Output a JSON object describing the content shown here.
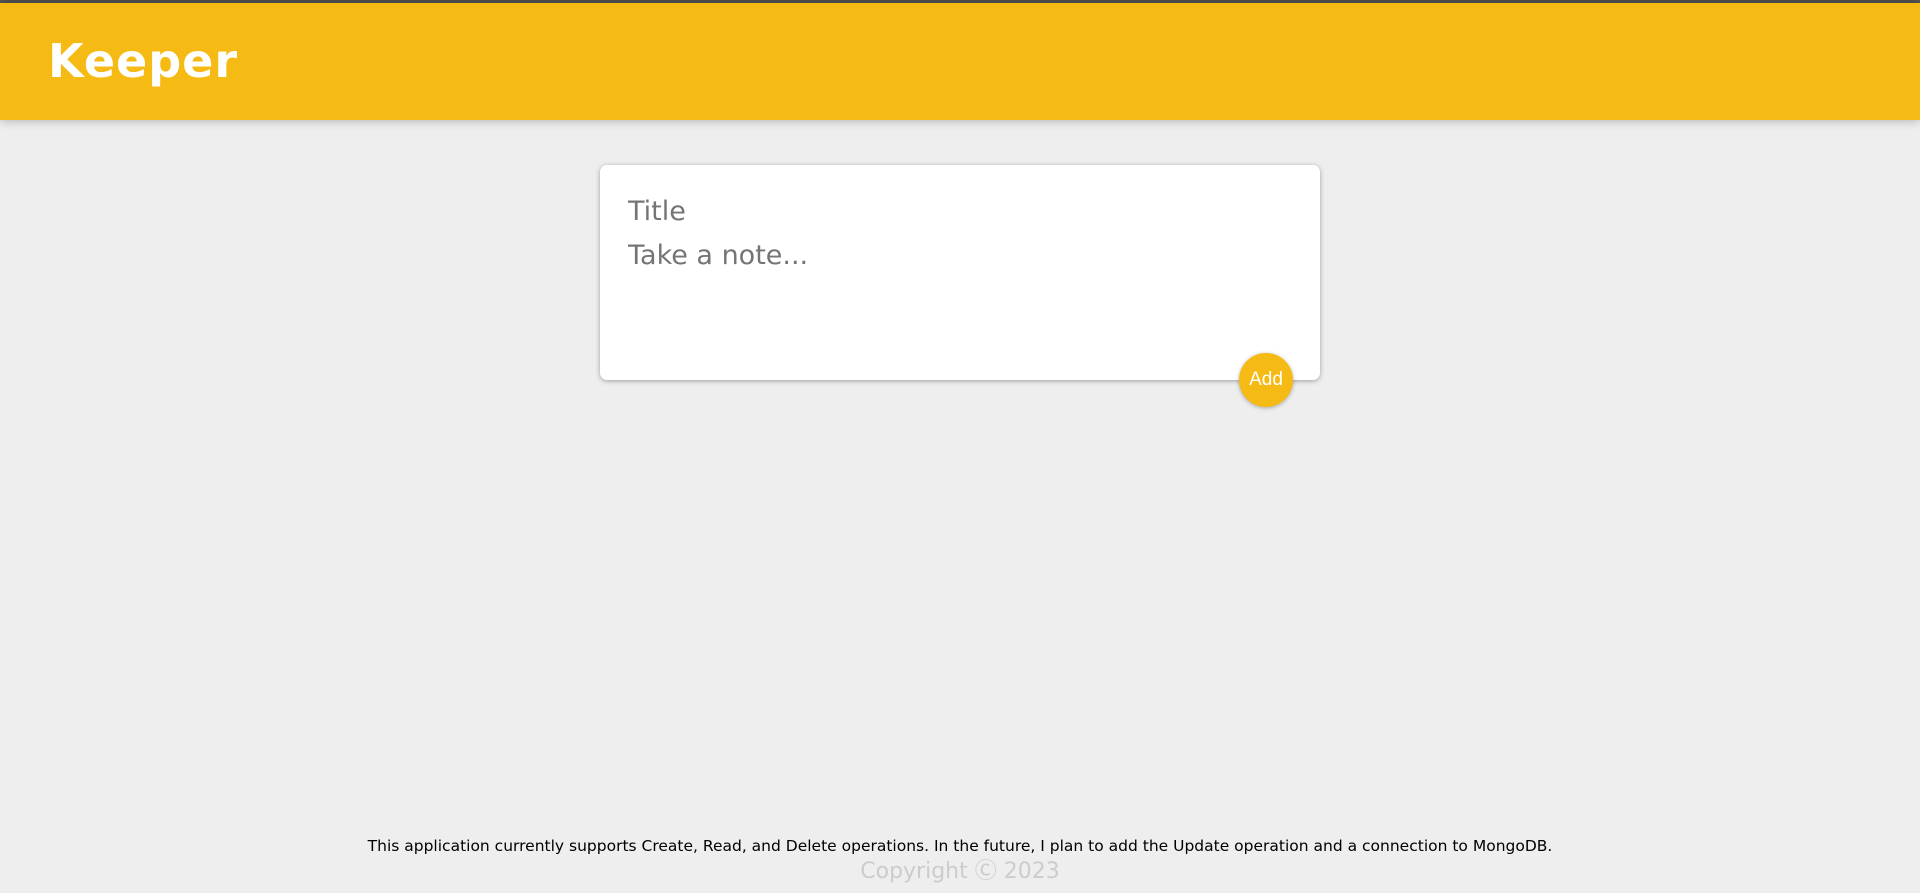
{
  "header": {
    "title": "Keeper"
  },
  "note_form": {
    "title_placeholder": "Title",
    "content_placeholder": "Take a note...",
    "add_label": "Add"
  },
  "footer": {
    "note": "This application currently supports Create, Read, and Delete operations. In the future, I plan to add the Update operation and a connection to MongoDB.",
    "copyright": "Copyright Ⓒ 2023"
  },
  "colors": {
    "accent": "#f5ba13",
    "background": "#eeeeee",
    "card": "#ffffff"
  }
}
